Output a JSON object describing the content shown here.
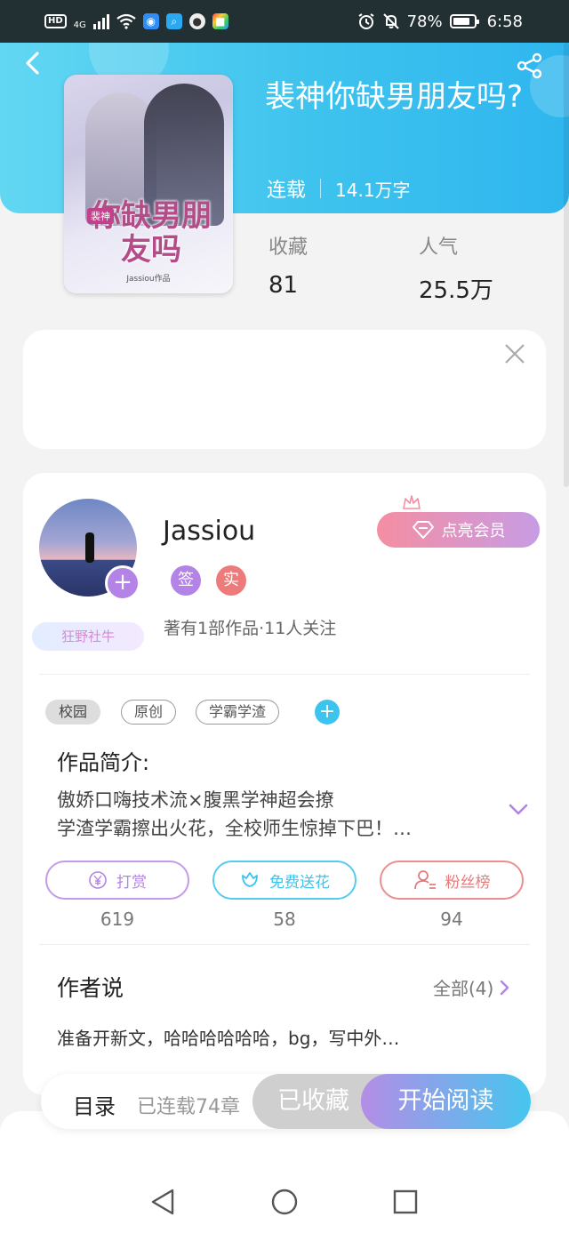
{
  "status_bar": {
    "hd": "HD",
    "network": "4G",
    "battery_percent": "78%",
    "time": "6:58"
  },
  "book": {
    "title": "裴神你缺男朋友吗?",
    "status": "连载",
    "word_count": "14.1万字",
    "cover": {
      "tag": "裴神",
      "title": "你缺男朋友吗",
      "credit": "Jassiou作品"
    },
    "stats": {
      "favorites_label": "收藏",
      "favorites_value": "81",
      "popularity_label": "人气",
      "popularity_value": "25.5万"
    }
  },
  "author": {
    "name": "Jassiou",
    "badge_sign": "签",
    "badge_real": "实",
    "info": "著有1部作品·11人关注",
    "title_badge": "狂野社牛",
    "vip_button": "点亮会员"
  },
  "tags": [
    "校园",
    "原创",
    "学霸学渣"
  ],
  "intro": {
    "title": "作品简介:",
    "line1": "傲娇口嗨技术流×腹黑学神超会撩",
    "line2": "学渣学霸擦出火花，全校师生惊掉下巴！…"
  },
  "actions": {
    "reward_label": "打赏",
    "reward_count": "619",
    "flower_label": "免费送花",
    "flower_count": "58",
    "fans_label": "粉丝榜",
    "fans_count": "94"
  },
  "author_says": {
    "title": "作者说",
    "all_label": "全部(4)",
    "text": "准备开新文，哈哈哈哈哈哈，bg，写中外…"
  },
  "bottom_bar": {
    "catalog": "目录",
    "chapters": "已连载74章",
    "collected": "已收藏",
    "start_reading": "开始阅读"
  },
  "colors": {
    "header_start": "#62d7f2",
    "header_end": "#2fb6ee",
    "purple": "#b483e6",
    "cyan": "#3cc4ef",
    "coral": "#e57c7c"
  }
}
